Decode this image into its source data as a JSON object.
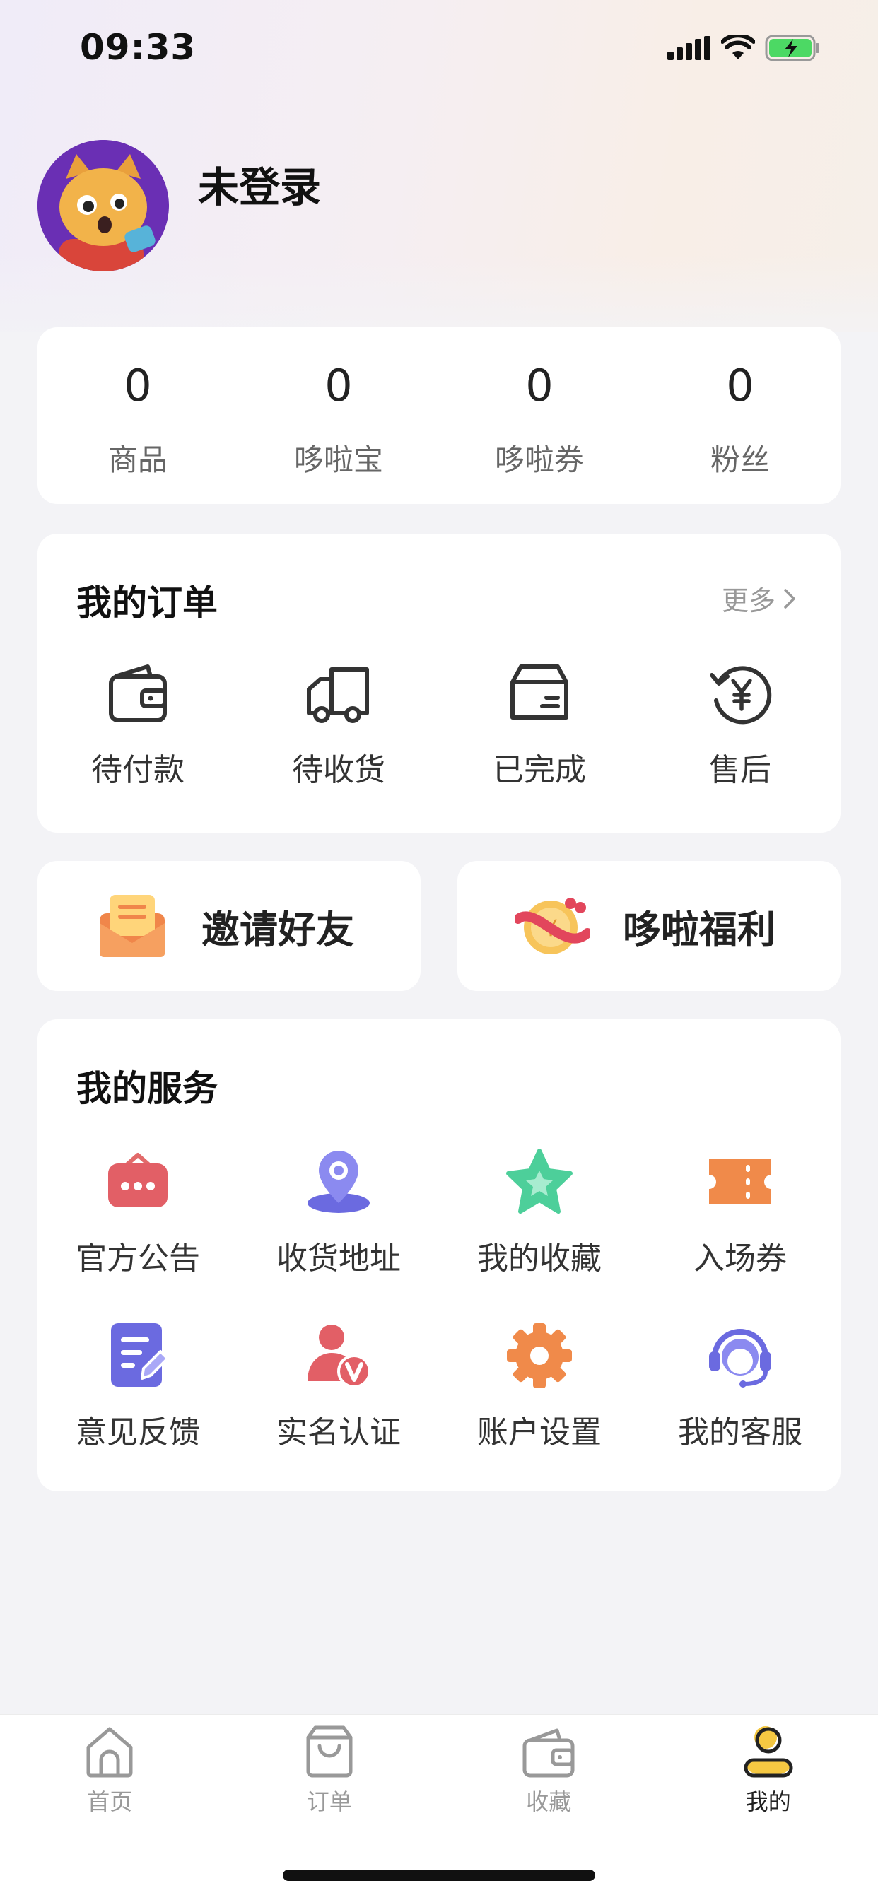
{
  "status_bar": {
    "time": "09:33",
    "icons": [
      "signal-icon",
      "wifi-icon",
      "battery-charging-icon"
    ]
  },
  "profile": {
    "username": "未登录",
    "avatar_icon": "cat-avatar-icon"
  },
  "stats": [
    {
      "value": "0",
      "label": "商品"
    },
    {
      "value": "0",
      "label": "哆啦宝"
    },
    {
      "value": "0",
      "label": "哆啦券"
    },
    {
      "value": "0",
      "label": "粉丝"
    }
  ],
  "orders": {
    "title": "我的订单",
    "more_label": "更多",
    "items": [
      {
        "label": "待付款",
        "icon": "wallet-icon"
      },
      {
        "label": "待收货",
        "icon": "truck-icon"
      },
      {
        "label": "已完成",
        "icon": "box-icon"
      },
      {
        "label": "售后",
        "icon": "refund-icon"
      }
    ]
  },
  "promos": [
    {
      "label": "邀请好友",
      "icon": "envelope-icon"
    },
    {
      "label": "哆啦福利",
      "icon": "coin-gift-icon"
    }
  ],
  "services": {
    "title": "我的服务",
    "items": [
      {
        "label": "官方公告",
        "icon": "announcement-icon"
      },
      {
        "label": "收货地址",
        "icon": "location-pin-icon"
      },
      {
        "label": "我的收藏",
        "icon": "star-icon"
      },
      {
        "label": "入场券",
        "icon": "ticket-icon"
      },
      {
        "label": "意见反馈",
        "icon": "feedback-icon"
      },
      {
        "label": "实名认证",
        "icon": "verified-user-icon"
      },
      {
        "label": "账户设置",
        "icon": "gear-icon"
      },
      {
        "label": "我的客服",
        "icon": "customer-service-icon"
      }
    ]
  },
  "tabbar": [
    {
      "label": "首页",
      "icon": "home-icon",
      "active": false
    },
    {
      "label": "订单",
      "icon": "bag-icon",
      "active": false
    },
    {
      "label": "收藏",
      "icon": "wallet-icon",
      "active": false
    },
    {
      "label": "我的",
      "icon": "user-icon",
      "active": true
    }
  ],
  "colors": {
    "accent": "#f5c842",
    "background": "#f3f3f6"
  }
}
